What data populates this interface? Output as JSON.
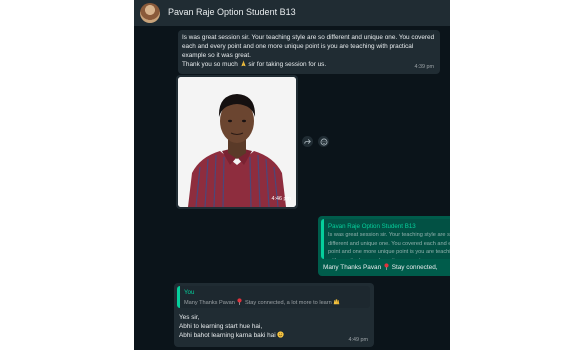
{
  "header": {
    "contact_name": "Pavan Raje Option Student B13"
  },
  "messages": {
    "first": {
      "text": "Is was great session sir. Your teaching style are so different and unique one. You covered each and every point and one more unique point is you are teaching with practical example so it was great.",
      "thanks_line": "Thank you so much",
      "thanks_line_end": "sir for taking session for us.",
      "time": "4:39 pm"
    },
    "photo": {
      "time": "4:46 pm"
    },
    "outgoing": {
      "quote_author": "Pavan Raje Option Student B13",
      "quote_text": "Is was great session sir. Your teaching style are so different and unique one. You covered each and every point and one more unique point is you are teaching with practical example so it was great....",
      "reply_start": "Many Thanks Pavan",
      "reply_end": "Stay connected,"
    },
    "incoming": {
      "quote_author": "You",
      "quote_text_start": "Many Thanks Pavan",
      "quote_text_end": "Stay connected, a lot more to learn",
      "line1": "Yes sir,",
      "line2": "Abhi to learning start hue hai,",
      "line3": "Abhi bahot learning karna baki hai",
      "time": "4:49 pm"
    }
  },
  "colors": {
    "chat_bg": "#0b141a",
    "incoming_bubble": "#202c33",
    "outgoing_bubble": "#005c4b",
    "accent": "#06cf9c"
  }
}
